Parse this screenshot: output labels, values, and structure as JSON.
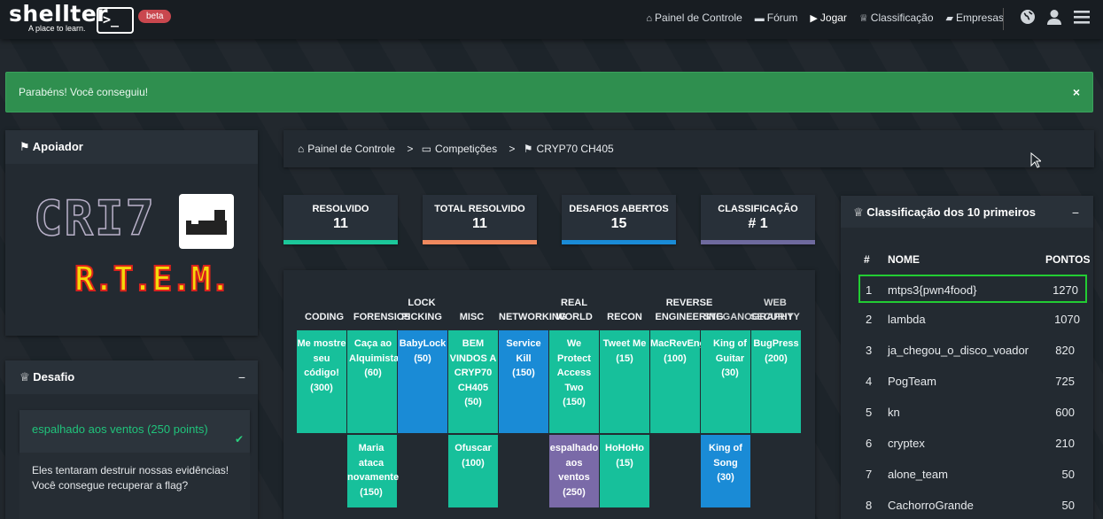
{
  "brand": {
    "name": "shellter",
    "tagline": "A place to learn.",
    "prompt": ">_",
    "badge": "beta"
  },
  "nav": {
    "items": [
      {
        "icon": "home-icon",
        "glyph": "⌂",
        "label": "Painel de Controle"
      },
      {
        "icon": "folder-icon",
        "glyph": "▬",
        "label": "Fórum"
      },
      {
        "icon": "play-icon",
        "glyph": "▶",
        "label": "Jogar"
      },
      {
        "icon": "trophy-icon",
        "glyph": "♕",
        "label": "Classificação"
      },
      {
        "icon": "briefcase-icon",
        "glyph": "▰",
        "label": "Empresas"
      }
    ]
  },
  "alert": {
    "message": "Parabéns! Você conseguiu!",
    "close": "×"
  },
  "sponsor": {
    "title": "Apoiador",
    "logo_text": "CRI7",
    "logo_sub": "R.T.E.M."
  },
  "challenge": {
    "title": "Desafio",
    "name": "espalhado aos ventos (250 points)",
    "description": "Eles tentaram destruir nossas evidências! Você consegue recuperar a flag?"
  },
  "breadcrumb": {
    "items": [
      "Painel de Controle",
      "Competições",
      "CRYP70 CH405"
    ],
    "sep": ">"
  },
  "stats": [
    {
      "label": "RESOLVIDO",
      "value": "11",
      "color": "#1cc79a"
    },
    {
      "label": "TOTAL RESOLVIDO",
      "value": "11",
      "color": "#f0895e"
    },
    {
      "label": "DESAFIOS ABERTOS",
      "value": "15",
      "color": "#1a8bd6"
    },
    {
      "label": "CLASSIFICAÇÃO",
      "value": "# 1",
      "color": "#6e6a9e"
    }
  ],
  "board": {
    "categories": [
      "CODING",
      "FORENSICS",
      "LOCK PICKING",
      "MISC",
      "NETWORKING",
      "REAL WORLD",
      "RECON",
      "REVERSE ENGINEERING",
      "STEGANOGRAPHY",
      "WEB SECURITY"
    ],
    "challenges": [
      {
        "cat": "CODING",
        "title": "Me mostre seu código!",
        "points": "(300)",
        "status": "solved"
      },
      {
        "cat": "FORENSICS",
        "title": "Caça ao Alquimista",
        "points": "(60)",
        "status": "solved"
      },
      {
        "cat": "FORENSICS",
        "title": "Maria ataca novamente",
        "points": "(150)",
        "status": "solved"
      },
      {
        "cat": "LOCK PICKING",
        "title": "BabyLock",
        "points": "(50)",
        "status": "open"
      },
      {
        "cat": "MISC",
        "title": "BEM VINDOS A CRYP70 CH405",
        "points": "(50)",
        "status": "solved"
      },
      {
        "cat": "MISC",
        "title": "Ofuscar",
        "points": "(100)",
        "status": "solved"
      },
      {
        "cat": "NETWORKING",
        "title": "Service Kill",
        "points": "(150)",
        "status": "open"
      },
      {
        "cat": "REAL WORLD",
        "title": "We Protect Access Two",
        "points": "(150)",
        "status": "solved"
      },
      {
        "cat": "REAL WORLD",
        "title": "espalhado aos ventos",
        "points": "(250)",
        "status": "current"
      },
      {
        "cat": "RECON",
        "title": "Tweet Me",
        "points": "(15)",
        "status": "solved"
      },
      {
        "cat": "RECON",
        "title": "HoHoHo",
        "points": "(15)",
        "status": "solved"
      },
      {
        "cat": "REVERSE ENGINEERING",
        "title": "MacRevEngR",
        "points": "(100)",
        "status": "solved"
      },
      {
        "cat": "STEGANOGRAPHY",
        "title": "King of Guitar",
        "points": "(30)",
        "status": "solved"
      },
      {
        "cat": "STEGANOGRAPHY",
        "title": "King of Song",
        "points": "(30)",
        "status": "open"
      },
      {
        "cat": "WEB SECURITY",
        "title": "BugPress",
        "points": "(200)",
        "status": "solved"
      }
    ]
  },
  "leaderboard": {
    "title": "Classificação dos 10 primeiros",
    "headers": [
      "#",
      "NOME",
      "PONTOS"
    ],
    "rows": [
      {
        "rank": "1",
        "name": "mtps3{pwn4food}",
        "points": "1270"
      },
      {
        "rank": "2",
        "name": "lambda",
        "points": "1070"
      },
      {
        "rank": "3",
        "name": "ja_chegou_o_disco_voador",
        "points": "820"
      },
      {
        "rank": "4",
        "name": "PogTeam",
        "points": "725"
      },
      {
        "rank": "5",
        "name": "kn",
        "points": "600"
      },
      {
        "rank": "6",
        "name": "cryptex",
        "points": "210"
      },
      {
        "rank": "7",
        "name": "alone_team",
        "points": "50"
      },
      {
        "rank": "8",
        "name": "CachorroGrande",
        "points": "50"
      }
    ]
  }
}
